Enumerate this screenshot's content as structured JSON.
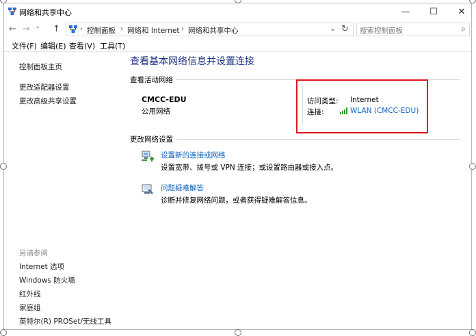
{
  "window": {
    "title": "网络和共享中心",
    "minimize": "—",
    "maximize": "☐",
    "close": "✕"
  },
  "nav": {
    "back": "←",
    "forward": "→",
    "recent": "⌄",
    "up": "↑",
    "breadcrumbs": [
      "控制面板",
      "网络和 Internet",
      "网络和共享中心"
    ],
    "separator": "›",
    "dropdown": "⌄",
    "refresh": "↻",
    "search_placeholder": "搜索控制面板",
    "search_icon": "⌕"
  },
  "menu": [
    "文件(F)",
    "编辑(E)",
    "查看(V)",
    "工具(T)"
  ],
  "sidebar": {
    "links": [
      "控制面板主页",
      "更改适配器设置",
      "更改高级共享设置"
    ],
    "see_also_heading": "另请参阅",
    "see_also": [
      "Internet 选项",
      "Windows 防火墙",
      "红外线",
      "家庭组",
      "英特尔(R) PROSet/无线工具"
    ]
  },
  "main": {
    "title": "查看基本网络信息并设置连接",
    "active_networks_label": "查看活动网络",
    "network_name": "CMCC-EDU",
    "network_type": "公用网络",
    "access_type_label": "访问类型:",
    "access_type_value": "Internet",
    "connection_label": "连接:",
    "connection_value": "WLAN (CMCC-EDU)",
    "change_settings_label": "更改网络设置",
    "tasks": [
      {
        "link": "设置新的连接或网络",
        "desc": "设置宽带、拨号或 VPN 连接；或设置路由器或接入点。",
        "icon": "network-setup-icon"
      },
      {
        "link": "问题疑难解答",
        "desc": "诊断并修复网络问题，或者获得疑难解答信息。",
        "icon": "troubleshoot-icon"
      }
    ]
  },
  "colors": {
    "highlight_box": "#e0141e",
    "link": "#0c63c5",
    "title": "#1e3287"
  }
}
